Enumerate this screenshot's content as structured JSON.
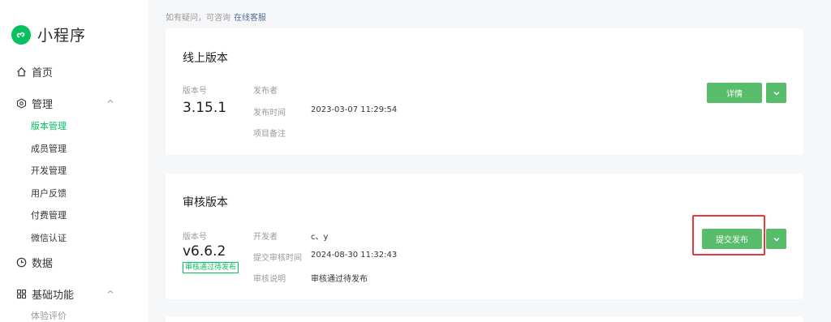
{
  "app": {
    "name": "小程序"
  },
  "sidebar": {
    "home": "首页",
    "manage": {
      "label": "管理",
      "items": [
        "版本管理",
        "成员管理",
        "开发管理",
        "用户反馈",
        "付费管理",
        "微信认证"
      ]
    },
    "data": "数据",
    "basic": {
      "label": "基础功能",
      "items": [
        "体验评价"
      ]
    }
  },
  "help": {
    "text": "如有疑问，可咨询",
    "link": "在线客服"
  },
  "online": {
    "title": "线上版本",
    "version_label": "版本号",
    "version": "3.15.1",
    "publisher_label": "发布者",
    "publisher": "",
    "time_label": "发布时间",
    "time": "2023-03-07 11:29:54",
    "note_label": "项目备注",
    "note": "",
    "detail_btn": "详情"
  },
  "review": {
    "title": "审核版本",
    "version_label": "版本号",
    "version": "v6.6.2",
    "status_badge": "审核通过待发布",
    "dev_label": "开发者",
    "dev": "c、y",
    "time_label": "提交审核时间",
    "time": "2024-08-30 11:32:43",
    "desc_label": "审核说明",
    "desc": "审核通过待发布",
    "publish_btn": "提交发布"
  },
  "colors": {
    "accent": "#07c160",
    "button": "#57bd6a",
    "highlight": "#e53b3b"
  }
}
